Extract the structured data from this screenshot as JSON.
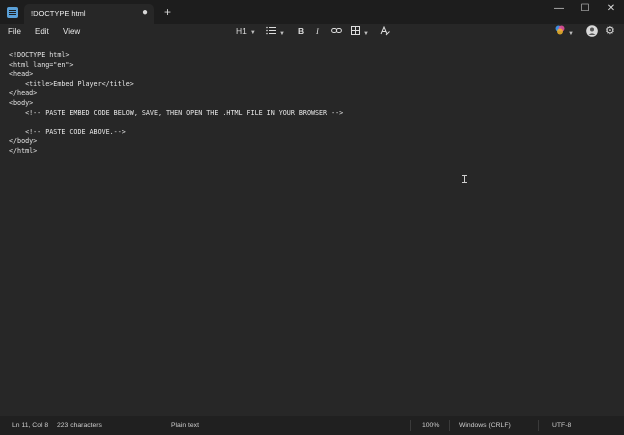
{
  "tab": {
    "title": "!DOCTYPE html",
    "modified_indicator": "●",
    "new_tab_label": "+"
  },
  "window_controls": {
    "minimize": "—",
    "maximize": "☐",
    "close": "✕"
  },
  "menu": [
    "File",
    "Edit",
    "View"
  ],
  "toolbar": {
    "heading": "H1",
    "list_icon": "list-icon",
    "bold": "B",
    "italic": "I",
    "link_icon": "link-icon",
    "table_icon": "table-icon",
    "clear_format_icon": "clear-formatting-icon"
  },
  "editor": {
    "lines": [
      "<!DOCTYPE html>",
      "<html lang=\"en\">",
      "<head>",
      "    <title>Embed Player</title>",
      "</head>",
      "<body>",
      "    <!-- PASTE EMBED CODE BELOW, SAVE, THEN OPEN THE .HTML FILE IN YOUR BROWSER -->",
      "",
      "    <!-- PASTE CODE ABOVE.-->",
      "</body>",
      "</html>"
    ]
  },
  "status": {
    "position": "Ln 11, Col 8",
    "characters": "223 characters",
    "format": "Plain text",
    "zoom": "100%",
    "line_ending": "Windows (CRLF)",
    "encoding": "UTF-8"
  },
  "colors": {
    "background": "#272727",
    "titlebar": "#1d1d1d",
    "statusbar": "#202020",
    "accent": "#5aa0d8"
  }
}
